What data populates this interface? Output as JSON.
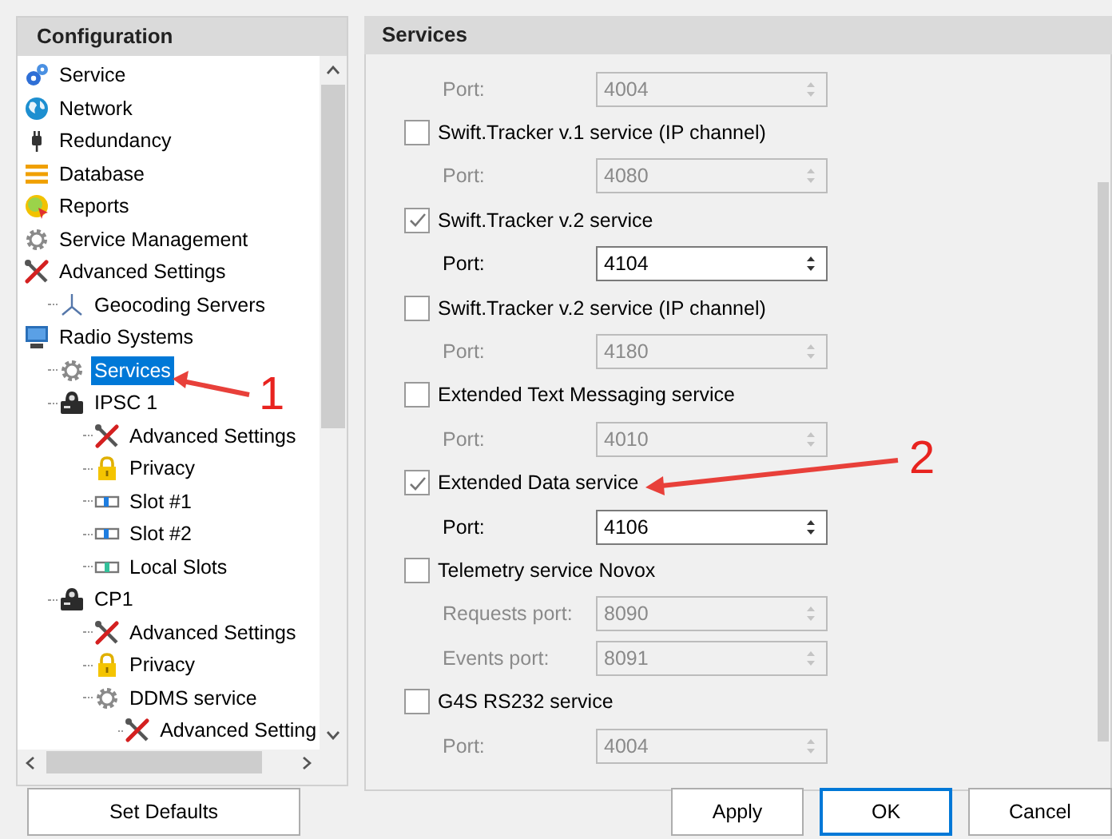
{
  "tree": {
    "title": "Configuration",
    "items": [
      {
        "label": "Service",
        "kind": "gear-blue",
        "selected": false
      },
      {
        "label": "Network",
        "kind": "globe",
        "selected": false
      },
      {
        "label": "Redundancy",
        "kind": "plug",
        "selected": false
      },
      {
        "label": "Database",
        "kind": "database",
        "selected": false
      },
      {
        "label": "Reports",
        "kind": "report",
        "selected": false
      },
      {
        "label": "Service Management",
        "kind": "gear",
        "selected": false
      },
      {
        "label": "Advanced Settings",
        "kind": "tools",
        "selected": false,
        "children": [
          {
            "label": "Geocoding Servers",
            "kind": "axes",
            "selected": false
          }
        ]
      },
      {
        "label": "Radio Systems",
        "kind": "monitor",
        "selected": false,
        "children": [
          {
            "label": "Services",
            "kind": "gear",
            "selected": true
          },
          {
            "label": "IPSC 1",
            "kind": "radio",
            "selected": false,
            "children": [
              {
                "label": "Advanced Settings",
                "kind": "tools",
                "selected": false
              },
              {
                "label": "Privacy",
                "kind": "lock",
                "selected": false
              },
              {
                "label": "Slot #1",
                "kind": "slot",
                "selected": false
              },
              {
                "label": "Slot #2",
                "kind": "slot",
                "selected": false
              },
              {
                "label": "Local Slots",
                "kind": "local-slot",
                "selected": false
              }
            ]
          },
          {
            "label": "CP1",
            "kind": "radio",
            "selected": false,
            "children": [
              {
                "label": "Advanced Settings",
                "kind": "tools",
                "selected": false
              },
              {
                "label": "Privacy",
                "kind": "lock",
                "selected": false
              },
              {
                "label": "DDMS service",
                "kind": "gear",
                "selected": false,
                "children": [
                  {
                    "label": "Advanced Setting",
                    "kind": "tools",
                    "selected": false
                  }
                ]
              }
            ]
          }
        ]
      }
    ]
  },
  "set_defaults_button": "Set Defaults",
  "services": {
    "title": "Services",
    "rows": [
      {
        "kind": "port",
        "label": "Port:",
        "value": "4004",
        "disabled": true
      },
      {
        "kind": "checkbox",
        "label": "Swift.Tracker v.1 service (IP channel)",
        "checked": false
      },
      {
        "kind": "port",
        "label": "Port:",
        "value": "4080",
        "disabled": true
      },
      {
        "kind": "checkbox",
        "label": "Swift.Tracker v.2 service",
        "checked": true
      },
      {
        "kind": "port",
        "label": "Port:",
        "value": "4104",
        "disabled": false
      },
      {
        "kind": "checkbox",
        "label": "Swift.Tracker v.2 service (IP channel)",
        "checked": false
      },
      {
        "kind": "port",
        "label": "Port:",
        "value": "4180",
        "disabled": true
      },
      {
        "kind": "checkbox",
        "label": "Extended Text Messaging service",
        "checked": false
      },
      {
        "kind": "port",
        "label": "Port:",
        "value": "4010",
        "disabled": true
      },
      {
        "kind": "checkbox",
        "label": "Extended Data service",
        "checked": true
      },
      {
        "kind": "port",
        "label": "Port:",
        "value": "4106",
        "disabled": false
      },
      {
        "kind": "checkbox",
        "label": "Telemetry service Novox",
        "checked": false
      },
      {
        "kind": "port",
        "label": "Requests port:",
        "value": "8090",
        "disabled": true
      },
      {
        "kind": "port",
        "label": "Events port:",
        "value": "8091",
        "disabled": true
      },
      {
        "kind": "checkbox",
        "label": "G4S RS232 service",
        "checked": false
      },
      {
        "kind": "port",
        "label": "Port:",
        "value": "4004",
        "disabled": true
      }
    ]
  },
  "buttons": [
    {
      "label": "Apply",
      "focused": false
    },
    {
      "label": "OK",
      "focused": true
    },
    {
      "label": "Cancel",
      "focused": false
    }
  ],
  "annotations": [
    {
      "label": "1"
    },
    {
      "label": "2"
    }
  ]
}
